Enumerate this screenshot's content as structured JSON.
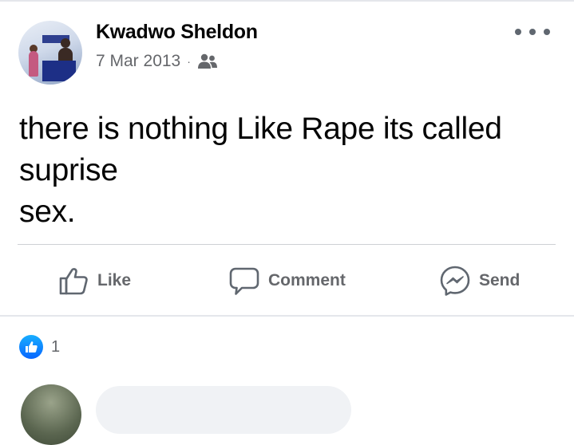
{
  "post": {
    "author": "Kwadwo Sheldon",
    "date": "7 Mar 2013",
    "separator": "·",
    "audience_icon": "friends-icon",
    "more_icon": "more-options-icon",
    "text_lines": [
      "there is nothing Like Rape its called",
      "suprise",
      "sex."
    ]
  },
  "actions": {
    "like": "Like",
    "comment": "Comment",
    "send": "Send"
  },
  "reactions": {
    "icon": "like-reaction-icon",
    "count": "1"
  },
  "colors": {
    "text": "#050505",
    "secondary": "#65676b",
    "like_blue": "#0866ff",
    "divider": "#ced0d4"
  }
}
